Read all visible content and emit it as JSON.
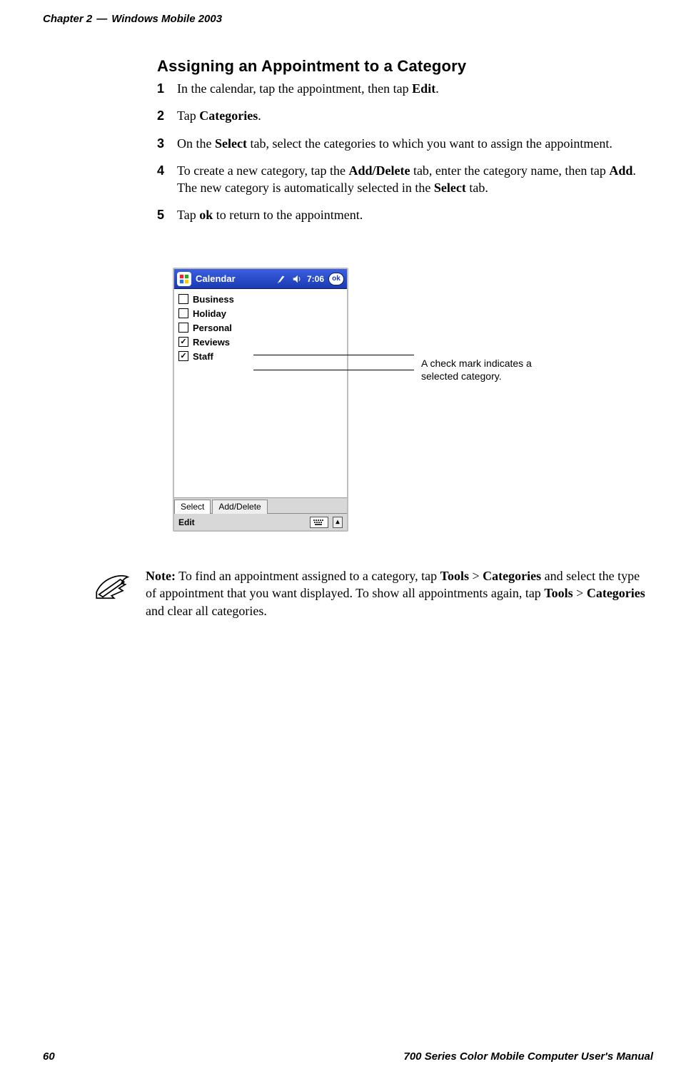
{
  "header": {
    "chapter_label": "Chapter 2",
    "dash": "—",
    "section_title": "Windows Mobile 2003"
  },
  "section_heading": "Assigning an Appointment to a Category",
  "steps": [
    {
      "n": "1",
      "pre": "In the calendar, tap the appointment, then tap ",
      "bold1": "Edit",
      "post1": "."
    },
    {
      "n": "2",
      "pre": "Tap ",
      "bold1": "Categories",
      "post1": "."
    },
    {
      "n": "3",
      "pre": "On the ",
      "bold1": "Select",
      "mid1": " tab, select the categories to which you want to assign the appointment.",
      "post1": ""
    },
    {
      "n": "4",
      "pre": "To create a new category, tap the ",
      "bold1": "Add/Delete",
      "mid1": " tab, enter the category name, then tap ",
      "bold2": "Add",
      "mid2": ". The new category is automatically selected in the ",
      "bold3": "Select",
      "post3": " tab."
    },
    {
      "n": "5",
      "pre": "Tap ",
      "bold1": "ok",
      "post1": " to return to the appointment."
    }
  ],
  "annotation": "A check mark indicates a selected category.",
  "note": {
    "lead": "Note:",
    "t1": " To find an appointment assigned to a category, tap ",
    "b1": "Tools",
    "gt1": " > ",
    "b2": "Categories",
    "t2": " and select the type of appointment that you want displayed. To show all appointments again, tap ",
    "b3": "Tools",
    "gt2": " > ",
    "b4": "Categories",
    "t3": " and clear all categories."
  },
  "pda": {
    "title": "Calendar",
    "time": "7:06",
    "ok": "ok",
    "tabs": {
      "select": "Select",
      "add_delete": "Add/Delete"
    },
    "bottom": {
      "edit": "Edit"
    },
    "categories": [
      {
        "label": "Business",
        "checked": false
      },
      {
        "label": "Holiday",
        "checked": false
      },
      {
        "label": "Personal",
        "checked": false
      },
      {
        "label": "Reviews",
        "checked": true
      },
      {
        "label": "Staff",
        "checked": true
      }
    ]
  },
  "footer": {
    "page": "60",
    "manual": "700 Series Color Mobile Computer User's Manual"
  },
  "icons": {
    "start": "windows-start-icon",
    "connectivity": "connectivity-icon",
    "speaker": "speaker-icon",
    "keyboard": "sip-keyboard-icon",
    "arrow_up": "input-panel-arrow-icon",
    "note_pen": "note-pen-icon"
  }
}
